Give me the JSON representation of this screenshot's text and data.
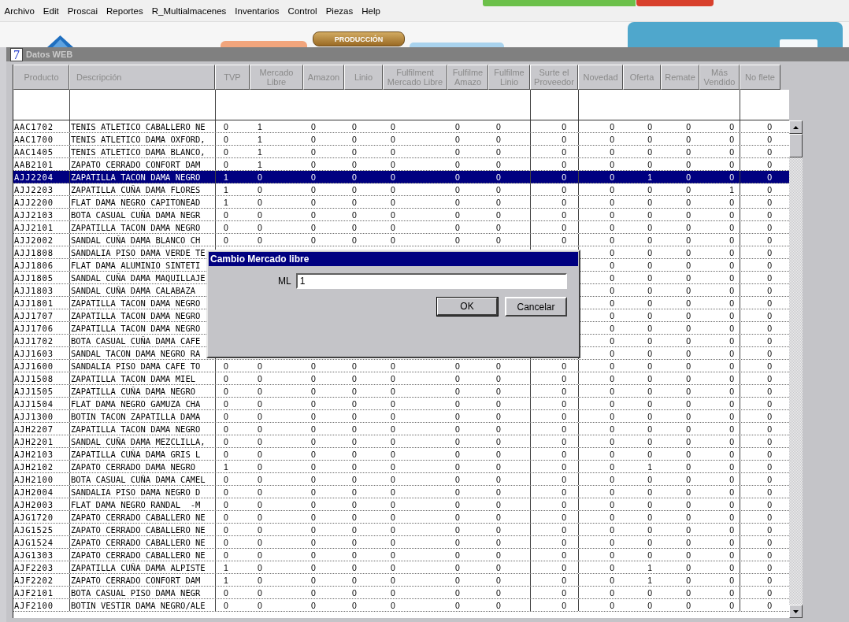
{
  "menu_bar": {
    "items": [
      "Archivo",
      "Edit",
      "Proscai",
      "Reportes",
      "R_Multialmacenes",
      "Inventarios",
      "Control",
      "Piezas",
      "Help"
    ]
  },
  "background_app": {
    "button": "PRODUCCIÓN"
  },
  "window": {
    "logo": "7",
    "title": "Datos WEB"
  },
  "table": {
    "columns": [
      "Producto",
      "Descripción",
      "TVP",
      "Mercado Libre",
      "Amazon",
      "Linio",
      "Fulfilment Mercado Libre",
      "Fulfilme Amazo",
      "Fulfilme Linio",
      "Surte el Proveedor",
      "Novedad",
      "Oferta",
      "Remate",
      "Más Vendido",
      "No flete"
    ],
    "rows": [
      {
        "product": "AAC1702",
        "description": "TENIS ATLETICO CABALLERO NE",
        "selected": false,
        "values": [
          "0",
          "1",
          "0",
          "0",
          "0",
          "0",
          "0",
          "0",
          "0",
          "0",
          "0",
          "0",
          "0"
        ]
      },
      {
        "product": "AAC1700",
        "description": "TENIS ATLETICO DAMA OXFORD,",
        "selected": false,
        "values": [
          "0",
          "1",
          "0",
          "0",
          "0",
          "0",
          "0",
          "0",
          "0",
          "0",
          "0",
          "0",
          "0"
        ]
      },
      {
        "product": "AAC1405",
        "description": "TENIS ATLETICO DAMA BLANCO,",
        "selected": false,
        "values": [
          "0",
          "1",
          "0",
          "0",
          "0",
          "0",
          "0",
          "0",
          "0",
          "0",
          "0",
          "0",
          "0"
        ]
      },
      {
        "product": "AAB2101",
        "description": "ZAPATO CERRADO CONFORT DAM",
        "selected": false,
        "values": [
          "0",
          "1",
          "0",
          "0",
          "0",
          "0",
          "0",
          "0",
          "0",
          "0",
          "0",
          "0",
          "0"
        ]
      },
      {
        "product": "AJJ2204",
        "description": "ZAPATILLA TACON DAMA NEGRO",
        "selected": true,
        "values": [
          "1",
          "0",
          "0",
          "0",
          "0",
          "0",
          "0",
          "0",
          "0",
          "1",
          "0",
          "0",
          "0"
        ]
      },
      {
        "product": "AJJ2203",
        "description": "ZAPATILLA CUÑA DAMA FLORES",
        "selected": false,
        "values": [
          "1",
          "0",
          "0",
          "0",
          "0",
          "0",
          "0",
          "0",
          "0",
          "0",
          "0",
          "1",
          "0"
        ]
      },
      {
        "product": "AJJ2200",
        "description": "FLAT DAMA NEGRO CAPITONEAD",
        "selected": false,
        "values": [
          "1",
          "0",
          "0",
          "0",
          "0",
          "0",
          "0",
          "0",
          "0",
          "0",
          "0",
          "0",
          "0"
        ]
      },
      {
        "product": "AJJ2103",
        "description": "BOTA CASUAL CUÑA DAMA NEGR",
        "selected": false,
        "values": [
          "0",
          "0",
          "0",
          "0",
          "0",
          "0",
          "0",
          "0",
          "0",
          "0",
          "0",
          "0",
          "0"
        ]
      },
      {
        "product": "AJJ2101",
        "description": "ZAPATILLA TACON DAMA NEGRO",
        "selected": false,
        "values": [
          "0",
          "0",
          "0",
          "0",
          "0",
          "0",
          "0",
          "0",
          "0",
          "0",
          "0",
          "0",
          "0"
        ]
      },
      {
        "product": "AJJ2002",
        "description": "SANDAL CUÑA DAMA BLANCO CH",
        "selected": false,
        "values": [
          "0",
          "0",
          "0",
          "0",
          "0",
          "0",
          "0",
          "0",
          "0",
          "0",
          "0",
          "0",
          "0"
        ]
      },
      {
        "product": "AJJ1808",
        "description": "SANDALIA PISO DAMA VERDE TE",
        "selected": false,
        "values": [
          "0",
          "0",
          "0",
          "0",
          "0"
        ]
      },
      {
        "product": "AJJ1806",
        "description": "FLAT DAMA ALUMINIO SINTETI",
        "selected": false,
        "values": [
          "0",
          "0",
          "0",
          "0",
          "0"
        ]
      },
      {
        "product": "AJJ1805",
        "description": "SANDAL CUÑA DAMA MAQUILLAJE",
        "selected": false,
        "values": [
          "0",
          "0",
          "0",
          "0",
          "0"
        ]
      },
      {
        "product": "AJJ1803",
        "description": "SANDAL CUÑA DAMA CALABAZA",
        "selected": false,
        "values": [
          "0",
          "0",
          "0",
          "0",
          "0"
        ]
      },
      {
        "product": "AJJ1801",
        "description": "ZAPATILLA TACON DAMA NEGRO",
        "selected": false,
        "values": [
          "0",
          "0",
          "0",
          "0",
          "0"
        ]
      },
      {
        "product": "AJJ1707",
        "description": "ZAPATILLA TACON DAMA NEGRO",
        "selected": false,
        "values": [
          "0",
          "0",
          "0",
          "0",
          "0"
        ]
      },
      {
        "product": "AJJ1706",
        "description": "ZAPATILLA TACON DAMA NEGRO",
        "selected": false,
        "values": [
          "0",
          "0",
          "0",
          "0",
          "0"
        ]
      },
      {
        "product": "AJJ1702",
        "description": "BOTA CASUAL CUÑA DAMA CAFE",
        "selected": false,
        "values": [
          "0",
          "0",
          "0",
          "0",
          "0"
        ]
      },
      {
        "product": "AJJ1603",
        "description": "SANDAL TACON DAMA NEGRO RA",
        "selected": false,
        "values": [
          "0",
          "0",
          "0",
          "0",
          "0"
        ]
      },
      {
        "product": "AJJ1600",
        "description": "SANDALIA PISO DAMA CAFE TO",
        "selected": false,
        "values": [
          "0",
          "0",
          "0",
          "0",
          "0",
          "0",
          "0",
          "0",
          "0",
          "0",
          "0",
          "0",
          "0"
        ]
      },
      {
        "product": "AJJ1508",
        "description": "ZAPATILLA TACON DAMA MIEL",
        "selected": false,
        "values": [
          "0",
          "0",
          "0",
          "0",
          "0",
          "0",
          "0",
          "0",
          "0",
          "0",
          "0",
          "0",
          "0"
        ]
      },
      {
        "product": "AJJ1505",
        "description": "ZAPATILLA CUÑA DAMA NEGRO",
        "selected": false,
        "values": [
          "0",
          "0",
          "0",
          "0",
          "0",
          "0",
          "0",
          "0",
          "0",
          "0",
          "0",
          "0",
          "0"
        ]
      },
      {
        "product": "AJJ1504",
        "description": "FLAT DAMA NEGRO GAMUZA CHA",
        "selected": false,
        "values": [
          "0",
          "0",
          "0",
          "0",
          "0",
          "0",
          "0",
          "0",
          "0",
          "0",
          "0",
          "0",
          "0"
        ]
      },
      {
        "product": "AJJ1300",
        "description": "BOTIN TACON ZAPATILLA DAMA",
        "selected": false,
        "values": [
          "0",
          "0",
          "0",
          "0",
          "0",
          "0",
          "0",
          "0",
          "0",
          "0",
          "0",
          "0",
          "0"
        ]
      },
      {
        "product": "AJH2207",
        "description": "ZAPATILLA TACON DAMA NEGRO",
        "selected": false,
        "values": [
          "0",
          "0",
          "0",
          "0",
          "0",
          "0",
          "0",
          "0",
          "0",
          "0",
          "0",
          "0",
          "0"
        ]
      },
      {
        "product": "AJH2201",
        "description": "SANDAL CUÑA DAMA MEZCLILLA,",
        "selected": false,
        "values": [
          "0",
          "0",
          "0",
          "0",
          "0",
          "0",
          "0",
          "0",
          "0",
          "0",
          "0",
          "0",
          "0"
        ]
      },
      {
        "product": "AJH2103",
        "description": "ZAPATILLA CUÑA DAMA GRIS L",
        "selected": false,
        "values": [
          "0",
          "0",
          "0",
          "0",
          "0",
          "0",
          "0",
          "0",
          "0",
          "0",
          "0",
          "0",
          "0"
        ]
      },
      {
        "product": "AJH2102",
        "description": "ZAPATO CERRADO DAMA NEGRO",
        "selected": false,
        "values": [
          "1",
          "0",
          "0",
          "0",
          "0",
          "0",
          "0",
          "0",
          "0",
          "1",
          "0",
          "0",
          "0"
        ]
      },
      {
        "product": "AJH2100",
        "description": "BOTA CASUAL CUÑA DAMA CAMEL",
        "selected": false,
        "values": [
          "0",
          "0",
          "0",
          "0",
          "0",
          "0",
          "0",
          "0",
          "0",
          "0",
          "0",
          "0",
          "0"
        ]
      },
      {
        "product": "AJH2004",
        "description": "SANDALIA PISO DAMA NEGRO D",
        "selected": false,
        "values": [
          "0",
          "0",
          "0",
          "0",
          "0",
          "0",
          "0",
          "0",
          "0",
          "0",
          "0",
          "0",
          "0"
        ]
      },
      {
        "product": "AJH2003",
        "description": "FLAT DAMA NEGRO RANDAL  -M",
        "selected": false,
        "values": [
          "0",
          "0",
          "0",
          "0",
          "0",
          "0",
          "0",
          "0",
          "0",
          "0",
          "0",
          "0",
          "0"
        ]
      },
      {
        "product": "AJG1720",
        "description": "ZAPATO CERRADO CABALLERO NE",
        "selected": false,
        "values": [
          "0",
          "0",
          "0",
          "0",
          "0",
          "0",
          "0",
          "0",
          "0",
          "0",
          "0",
          "0",
          "0"
        ]
      },
      {
        "product": "AJG1525",
        "description": "ZAPATO CERRADO CABALLERO NE",
        "selected": false,
        "values": [
          "0",
          "0",
          "0",
          "0",
          "0",
          "0",
          "0",
          "0",
          "0",
          "0",
          "0",
          "0",
          "0"
        ]
      },
      {
        "product": "AJG1524",
        "description": "ZAPATO CERRADO CABALLERO NE",
        "selected": false,
        "values": [
          "0",
          "0",
          "0",
          "0",
          "0",
          "0",
          "0",
          "0",
          "0",
          "0",
          "0",
          "0",
          "0"
        ]
      },
      {
        "product": "AJG1303",
        "description": "ZAPATO CERRADO CABALLERO NE",
        "selected": false,
        "values": [
          "0",
          "0",
          "0",
          "0",
          "0",
          "0",
          "0",
          "0",
          "0",
          "0",
          "0",
          "0",
          "0"
        ]
      },
      {
        "product": "AJF2203",
        "description": "ZAPATILLA CUÑA DAMA ALPISTE",
        "selected": false,
        "values": [
          "1",
          "0",
          "0",
          "0",
          "0",
          "0",
          "0",
          "0",
          "0",
          "1",
          "0",
          "0",
          "0"
        ]
      },
      {
        "product": "AJF2202",
        "description": "ZAPATO CERRADO CONFORT DAM",
        "selected": false,
        "values": [
          "1",
          "0",
          "0",
          "0",
          "0",
          "0",
          "0",
          "0",
          "0",
          "1",
          "0",
          "0",
          "0"
        ]
      },
      {
        "product": "AJF2101",
        "description": "BOTA CASUAL PISO DAMA NEGR",
        "selected": false,
        "values": [
          "0",
          "0",
          "0",
          "0",
          "0",
          "0",
          "0",
          "0",
          "0",
          "0",
          "0",
          "0",
          "0"
        ]
      },
      {
        "product": "AJF2100",
        "description": "BOTIN VESTIR DAMA NEGRO/ALE",
        "selected": false,
        "values": [
          "0",
          "0",
          "0",
          "0",
          "0",
          "0",
          "0",
          "0",
          "0",
          "0",
          "0",
          "0",
          "0"
        ]
      }
    ]
  },
  "dialog": {
    "title": "Cambio Mercado libre",
    "field_label": "ML",
    "field_value": "1",
    "buttons": [
      {
        "label": "OK",
        "default": true
      },
      {
        "label": "Cancelar",
        "default": false
      }
    ]
  }
}
